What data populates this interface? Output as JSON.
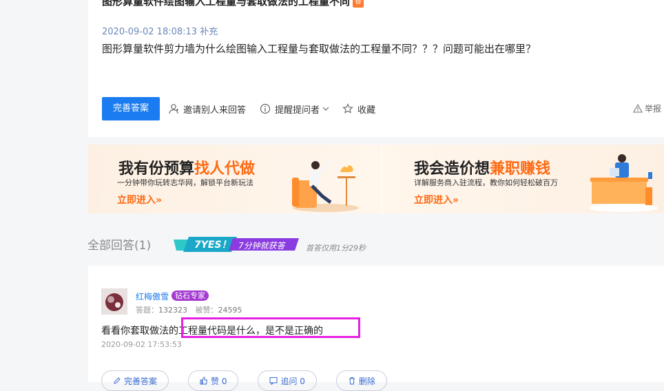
{
  "question": {
    "title": "图形算量软件绘图输入工程量与套取做法的工程量不同",
    "title_tag": "香",
    "meta": "2020-09-02 18:08:13 补充",
    "body": "图形算量软件剪力墙为什么绘图输入工程量与套取做法的工程量不同？？？问题可能出在哪里？",
    "actions": {
      "complete_answer": "完善答案",
      "invite": "邀请别人来回答",
      "remind": "提醒提问者",
      "collect": "收藏",
      "report": "举报"
    }
  },
  "banner": {
    "left": {
      "title_a": "我有份预算",
      "title_b": "找人代做",
      "sub": "一分钟带你玩转志华网，解锁平台新玩法",
      "cta": "立即进入»"
    },
    "right": {
      "title_a": "我会造价想",
      "title_b": "兼职赚钱",
      "sub": "详解服务商入驻流程，教你如何轻松破百万",
      "cta": "立即进入»"
    },
    "colors": {
      "accent": "#ff6a13"
    }
  },
  "answers_header": {
    "label": "全部回答(1)",
    "badge_a": "7YES！",
    "badge_b": "7分钟就获答",
    "first_answer_note": "首答仅用1分29秒"
  },
  "answer": {
    "username": "红梅傲雪",
    "user_badge": "钻石专家",
    "answers_label": "答题：",
    "answers_count": "132323",
    "likes_label": "被赞：",
    "likes_count": "24595",
    "text": "看看你套取做法的工程量代码是什么，是不是正确的",
    "date": "2020-09-02 17:53:53",
    "actions": {
      "complete": "完善答案",
      "like": "赞 0",
      "follow_up": "追问 0",
      "delete": "删除"
    }
  }
}
